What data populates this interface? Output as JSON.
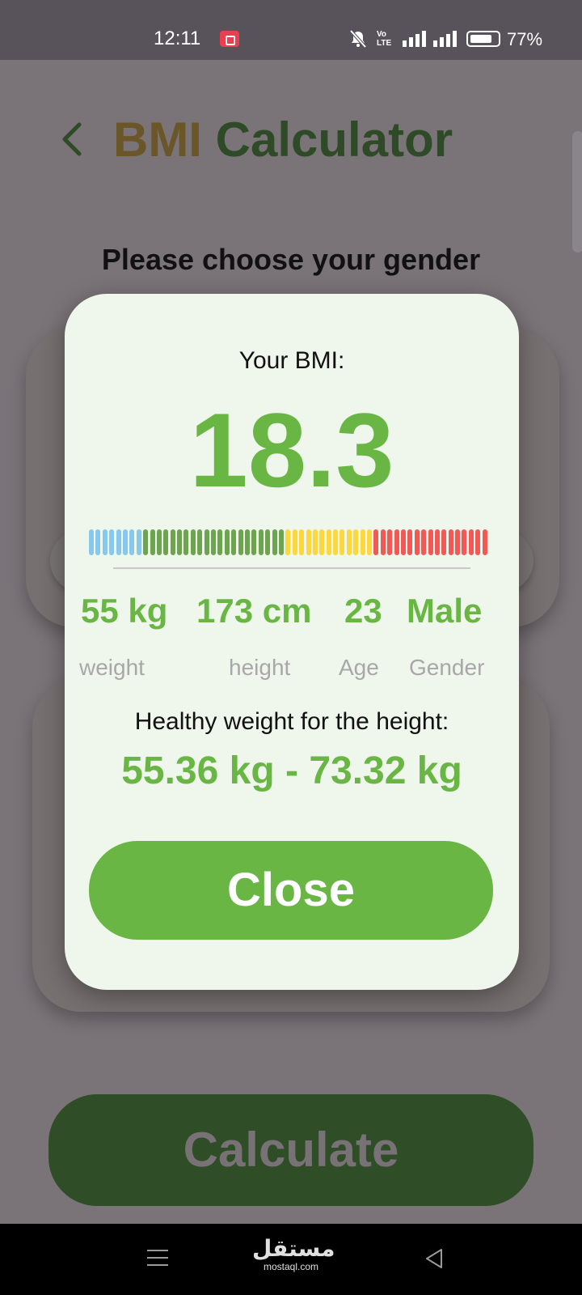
{
  "status_bar": {
    "time": "12:11",
    "volte_line1": "Vo",
    "volte_line2": "LTE",
    "battery_percent": "77%",
    "battery_level": 0.77
  },
  "header": {
    "title_part1": "BMI",
    "title_part2": "Calculator",
    "title_part1_color": "#6a5628",
    "title_part2_color": "#2e4a26",
    "back_icon": "chevron-left-icon"
  },
  "main": {
    "gender_prompt": "Please choose your gender",
    "calculate_label": "Calculate"
  },
  "dialog": {
    "bmi_label": "Your BMI:",
    "bmi_value": "18.3",
    "scale": {
      "segments": [
        {
          "color": "#88c8ec",
          "count": 8
        },
        {
          "color": "#6ea450",
          "count": 21
        },
        {
          "color": "#fcd83c",
          "count": 13
        },
        {
          "color": "#f25856",
          "count": 17
        }
      ]
    },
    "stats": [
      {
        "value": "55 kg",
        "label": "weight"
      },
      {
        "value": "173 cm",
        "label": "height"
      },
      {
        "value": "23",
        "label": "Age"
      },
      {
        "value": "Male",
        "label": "Gender"
      }
    ],
    "healthy_label": "Healthy weight for the height:",
    "healthy_range": "55.36 kg - 73.32 kg",
    "close_label": "Close",
    "accent_color": "#6ab645"
  },
  "nav_bar": {
    "home_logo": "مستقل",
    "home_sub": "mostaql.com",
    "menu_icon": "menu-icon",
    "back_icon": "back-triangle-icon"
  }
}
